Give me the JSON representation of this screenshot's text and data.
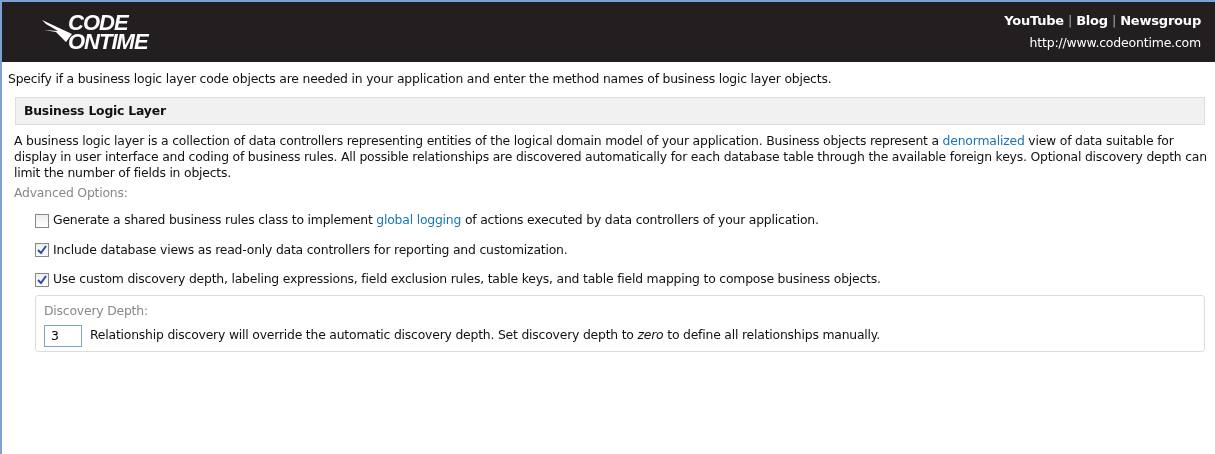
{
  "header": {
    "logo": [
      "CODE",
      "ONTIME"
    ],
    "links": [
      {
        "label": "YouTube"
      },
      {
        "label": "Blog"
      },
      {
        "label": "Newsgroup"
      }
    ],
    "separator": "|",
    "url": "http://www.codeontime.com"
  },
  "intro": "Specify if a business logic layer code objects are needed in your application and enter the method names of business logic layer objects.",
  "section": {
    "title": "Business Logic Layer",
    "description": [
      {
        "kind": "text",
        "text": "A business logic layer is a collection of data controllers representing entities of the logical domain model of your application. Business objects represent a "
      },
      {
        "kind": "link",
        "text": "denormalized"
      },
      {
        "kind": "text",
        "text": " view of data suitable for display in user interface and coding of business rules. All possible relationships are discovered automatically for each database table through the available foreign keys. Optional discovery depth can limit the number of fields in objects."
      }
    ],
    "advanced_label": "Advanced Options:",
    "options": [
      {
        "checked": false,
        "parts": [
          {
            "kind": "text",
            "text": "Generate a shared business rules class to implement "
          },
          {
            "kind": "link",
            "text": "global logging"
          },
          {
            "kind": "text",
            "text": " of actions executed by data controllers of your application."
          }
        ]
      },
      {
        "checked": true,
        "parts": [
          {
            "kind": "text",
            "text": "Include database views as read-only data controllers for reporting and customization."
          }
        ]
      },
      {
        "checked": true,
        "parts": [
          {
            "kind": "text",
            "text": "Use custom discovery depth, labeling expressions, field exclusion rules, table keys, and table field mapping to compose business objects."
          }
        ]
      }
    ],
    "discovery": {
      "label": "Discovery Depth:",
      "value": "3",
      "hint": "Relationship discovery will override the automatic discovery depth. Set discovery depth to *zero* to define all relationships manually."
    }
  }
}
